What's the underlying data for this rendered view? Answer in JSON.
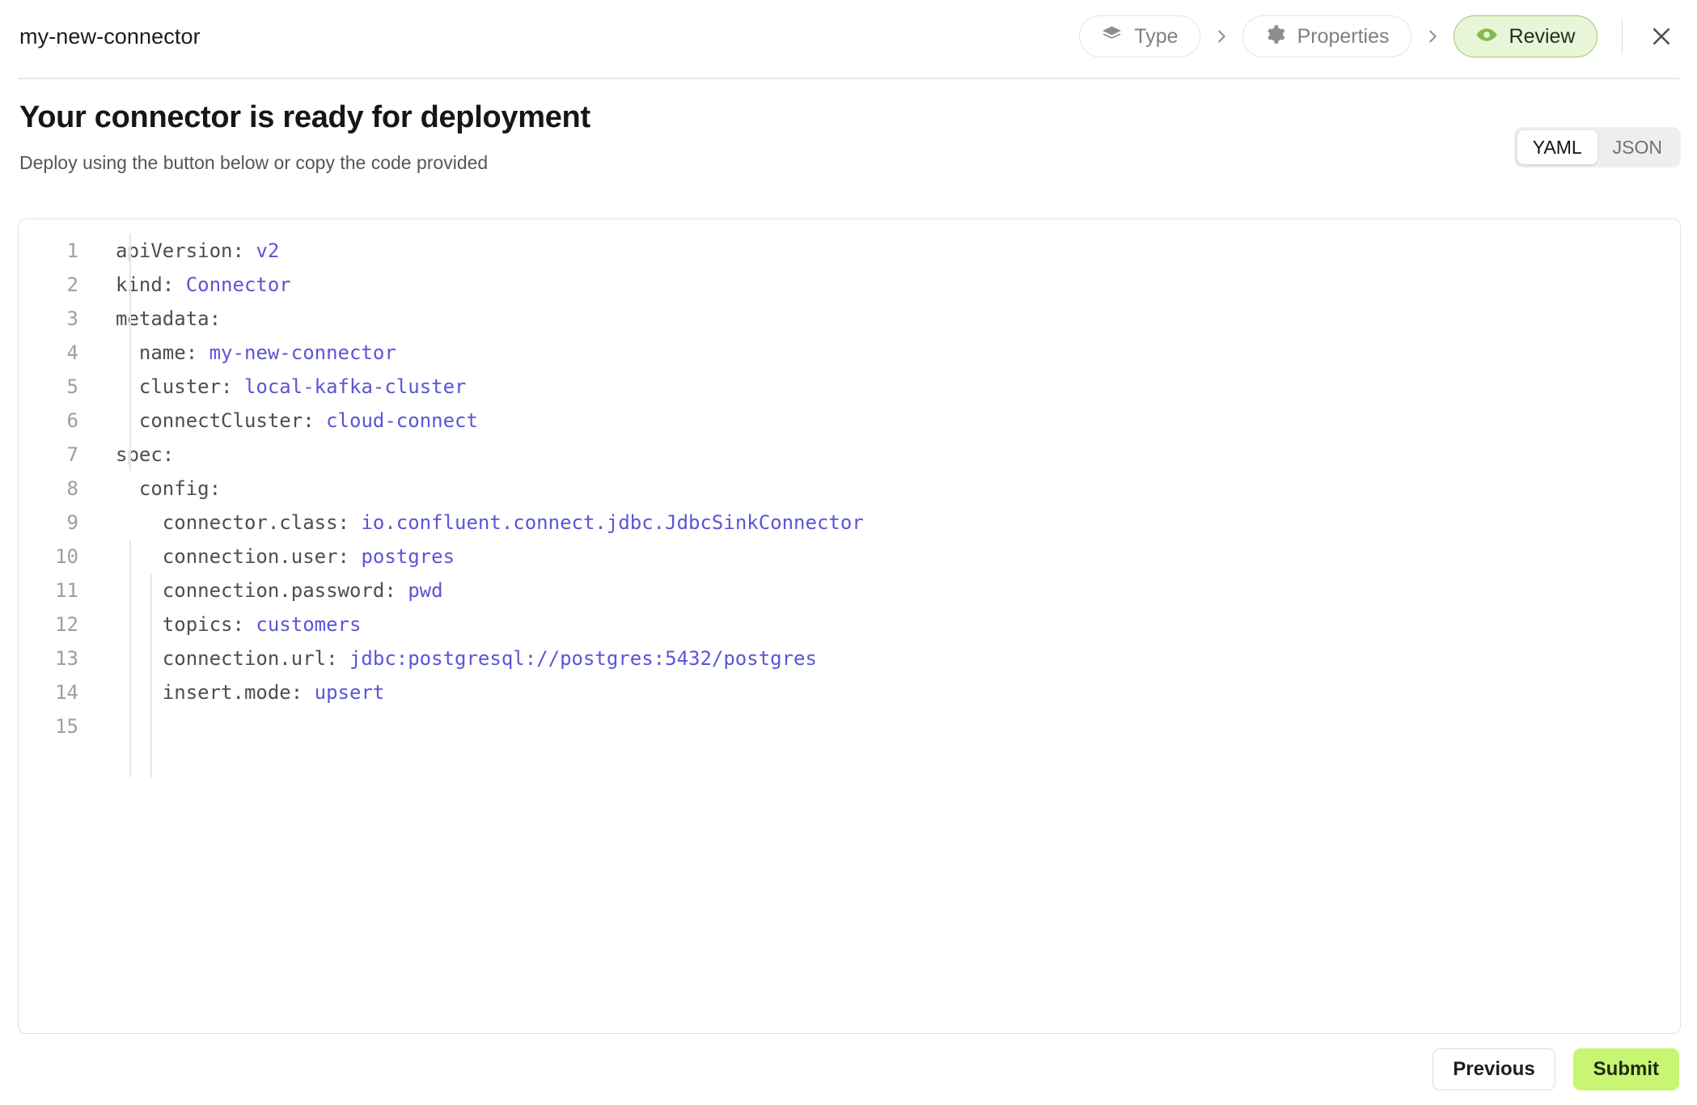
{
  "header": {
    "connector_name": "my-new-connector",
    "steps": [
      {
        "label": "Type",
        "icon": "layers-icon",
        "active": false
      },
      {
        "label": "Properties",
        "icon": "gear-icon",
        "active": false
      },
      {
        "label": "Review",
        "icon": "eye-icon",
        "active": true
      }
    ],
    "separator_icon": "chevron-right-icon",
    "close_icon": "close-icon"
  },
  "main": {
    "title": "Your connector is ready for deployment",
    "subtitle": "Deploy using the button below or copy the code provided",
    "format_toggle": {
      "options": [
        "YAML",
        "JSON"
      ],
      "selected": "YAML"
    }
  },
  "code": {
    "language": "yaml",
    "lines": [
      {
        "n": "1",
        "key": "apiVersion: ",
        "value": "v2",
        "indent": 0
      },
      {
        "n": "2",
        "key": "kind: ",
        "value": "Connector",
        "indent": 0
      },
      {
        "n": "3",
        "key": "metadata:",
        "value": "",
        "indent": 0
      },
      {
        "n": "4",
        "key": "  name: ",
        "value": "my-new-connector",
        "indent": 1
      },
      {
        "n": "5",
        "key": "  cluster: ",
        "value": "local-kafka-cluster",
        "indent": 1
      },
      {
        "n": "6",
        "key": "  connectCluster: ",
        "value": "cloud-connect",
        "indent": 1
      },
      {
        "n": "7",
        "key": "spec:",
        "value": "",
        "indent": 0
      },
      {
        "n": "8",
        "key": "  config:",
        "value": "",
        "indent": 1
      },
      {
        "n": "9",
        "key": "    connector.class: ",
        "value": "io.confluent.connect.jdbc.JdbcSinkConnector",
        "indent": 2
      },
      {
        "n": "10",
        "key": "    connection.user: ",
        "value": "postgres",
        "indent": 2
      },
      {
        "n": "11",
        "key": "    connection.password: ",
        "value": "pwd",
        "indent": 2
      },
      {
        "n": "12",
        "key": "    topics: ",
        "value": "customers",
        "indent": 2
      },
      {
        "n": "13",
        "key": "    connection.url: ",
        "value": "jdbc:postgresql://postgres:5432/postgres",
        "indent": 2
      },
      {
        "n": "14",
        "key": "    insert.mode: ",
        "value": "upsert",
        "indent": 2
      },
      {
        "n": "15",
        "key": "",
        "value": "",
        "indent": 0
      }
    ]
  },
  "footer": {
    "previous_label": "Previous",
    "submit_label": "Submit"
  },
  "colors": {
    "accent_green": "#c8f573",
    "active_step_bg": "#e9f5d9",
    "active_step_border": "#9ccb62",
    "code_value": "#5b55d6",
    "code_key": "#4a4f52",
    "line_number": "#9aa09c"
  }
}
